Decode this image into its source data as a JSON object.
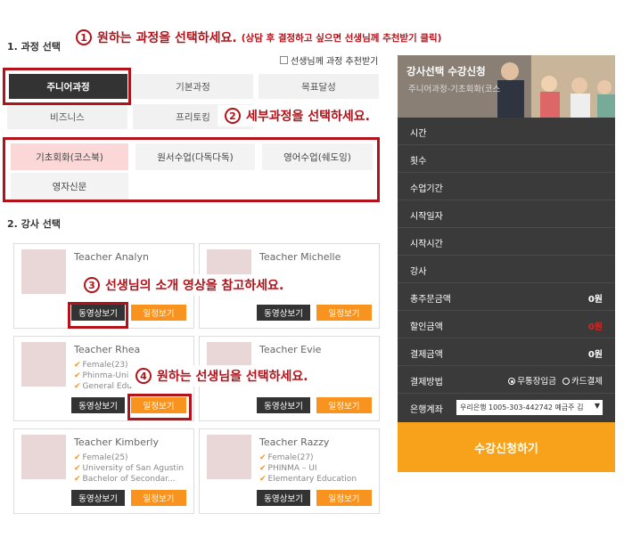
{
  "annotations": {
    "a1": {
      "num": "1",
      "text": "원하는 과정을 선택하세요.",
      "note": "(상담 후 결정하고 싶으면 선생님께 추천받기 클릭)"
    },
    "a2": {
      "num": "2",
      "text": "세부과정을 선택하세요."
    },
    "a3": {
      "num": "3",
      "text": "선생님의 소개 영상을 참고하세요."
    },
    "a4": {
      "num": "4",
      "text": "원하는 선생님을 선택하세요."
    }
  },
  "course_section": {
    "title": "1. 과정 선택",
    "recommend_label": "선생님께 과정 추천받기",
    "courses": [
      "주니어과정",
      "기본과정",
      "목표달성",
      "비즈니스",
      "프리토킹"
    ],
    "subcourses": [
      "기초회화(코스북)",
      "원서수업(다독다독)",
      "영어수업(쉐도잉)",
      "영자신문"
    ]
  },
  "teacher_section": {
    "title": "2. 강사 선택",
    "video_label": "동영상보기",
    "schedule_label": "일정보기",
    "teachers": [
      {
        "name": "Teacher Analyn",
        "info": []
      },
      {
        "name": "Teacher Michelle",
        "info": []
      },
      {
        "name": "Teacher Rhea",
        "info": [
          "Female(23)",
          "Phinma-Uni",
          "General Edu"
        ]
      },
      {
        "name": "Teacher Evie",
        "info": []
      },
      {
        "name": "Teacher Kimberly",
        "info": [
          "Female(25)",
          "University of San Agustin",
          "Bachelor of Secondar..."
        ]
      },
      {
        "name": "Teacher Razzy",
        "info": [
          "Female(27)",
          "PHINMA – UI",
          "Elementary Education"
        ]
      }
    ]
  },
  "summary_panel": {
    "title": "강사선택 수강신청",
    "subtitle": "주니어과정-기초회화(코스",
    "rows": [
      {
        "label": "시간",
        "value": ""
      },
      {
        "label": "횟수",
        "value": ""
      },
      {
        "label": "수업기간",
        "value": ""
      },
      {
        "label": "시작일자",
        "value": ""
      },
      {
        "label": "시작시간",
        "value": ""
      },
      {
        "label": "강사",
        "value": ""
      },
      {
        "label": "총주문금액",
        "value": "0원"
      },
      {
        "label": "할인금액",
        "value": "0원"
      },
      {
        "label": "결제금액",
        "value": "0원"
      }
    ],
    "payment_label": "결제방법",
    "payment_options": [
      "무통장입금",
      "카드결제"
    ],
    "bank_label": "은행계좌",
    "bank_value": "우리은행 1005-303-442742 예금주 김",
    "submit_label": "수강신청하기"
  },
  "colors": {
    "accent_red": "#b4121a",
    "orange": "#f7931e",
    "dark": "#333333"
  }
}
